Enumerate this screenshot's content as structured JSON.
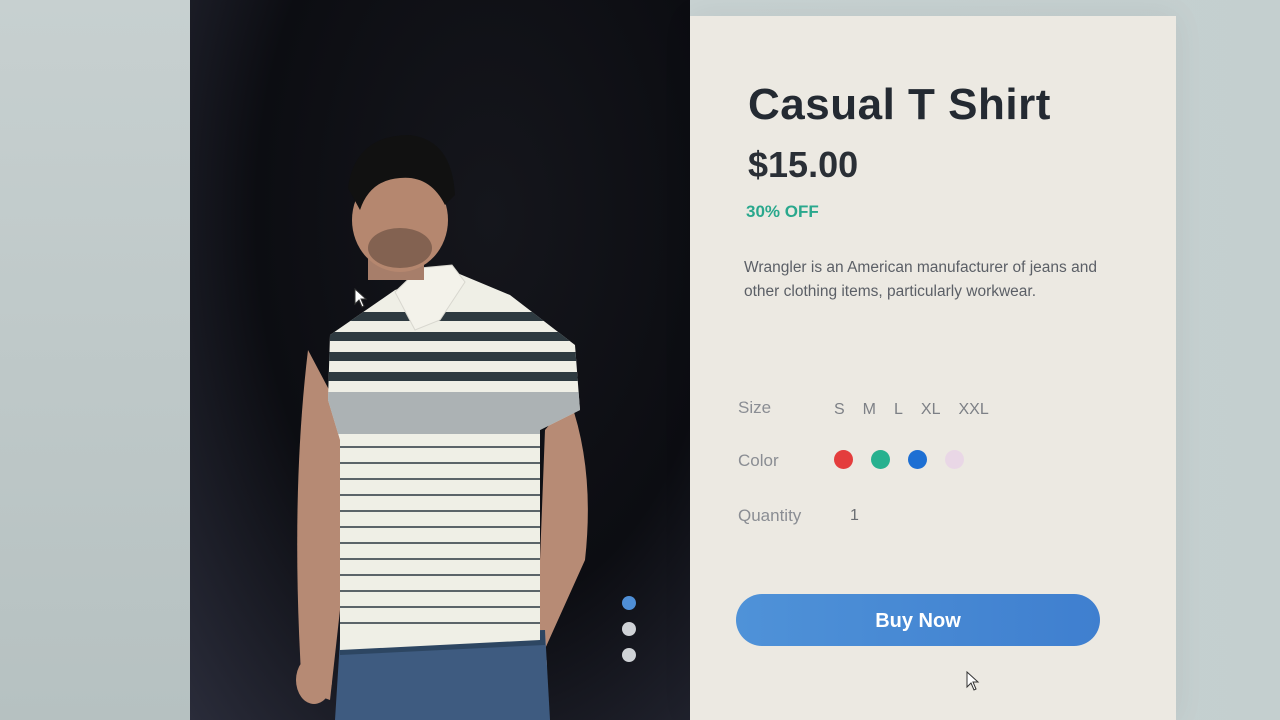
{
  "product": {
    "title": "Casual T Shirt",
    "price": "$15.00",
    "discount": "30% OFF",
    "description": "Wrangler is an American manufacturer of jeans and other clothing items, particularly workwear."
  },
  "options": {
    "size_label": "Size",
    "sizes": [
      "S",
      "M",
      "L",
      "XL",
      "XXL"
    ],
    "color_label": "Color",
    "colors": [
      "#e43d3d",
      "#27b18f",
      "#1d6fd3",
      "#e9d7e6"
    ],
    "quantity_label": "Quantity",
    "quantity_value": "1"
  },
  "actions": {
    "buy_label": "Buy Now"
  },
  "carousel": {
    "slide_count": 3,
    "active_index": 0
  },
  "theme": {
    "accent": "#4a8ad6",
    "discount": "#2aa88d",
    "text_dark": "#242a32"
  },
  "icons": [
    "arrow-cursor-icon"
  ]
}
